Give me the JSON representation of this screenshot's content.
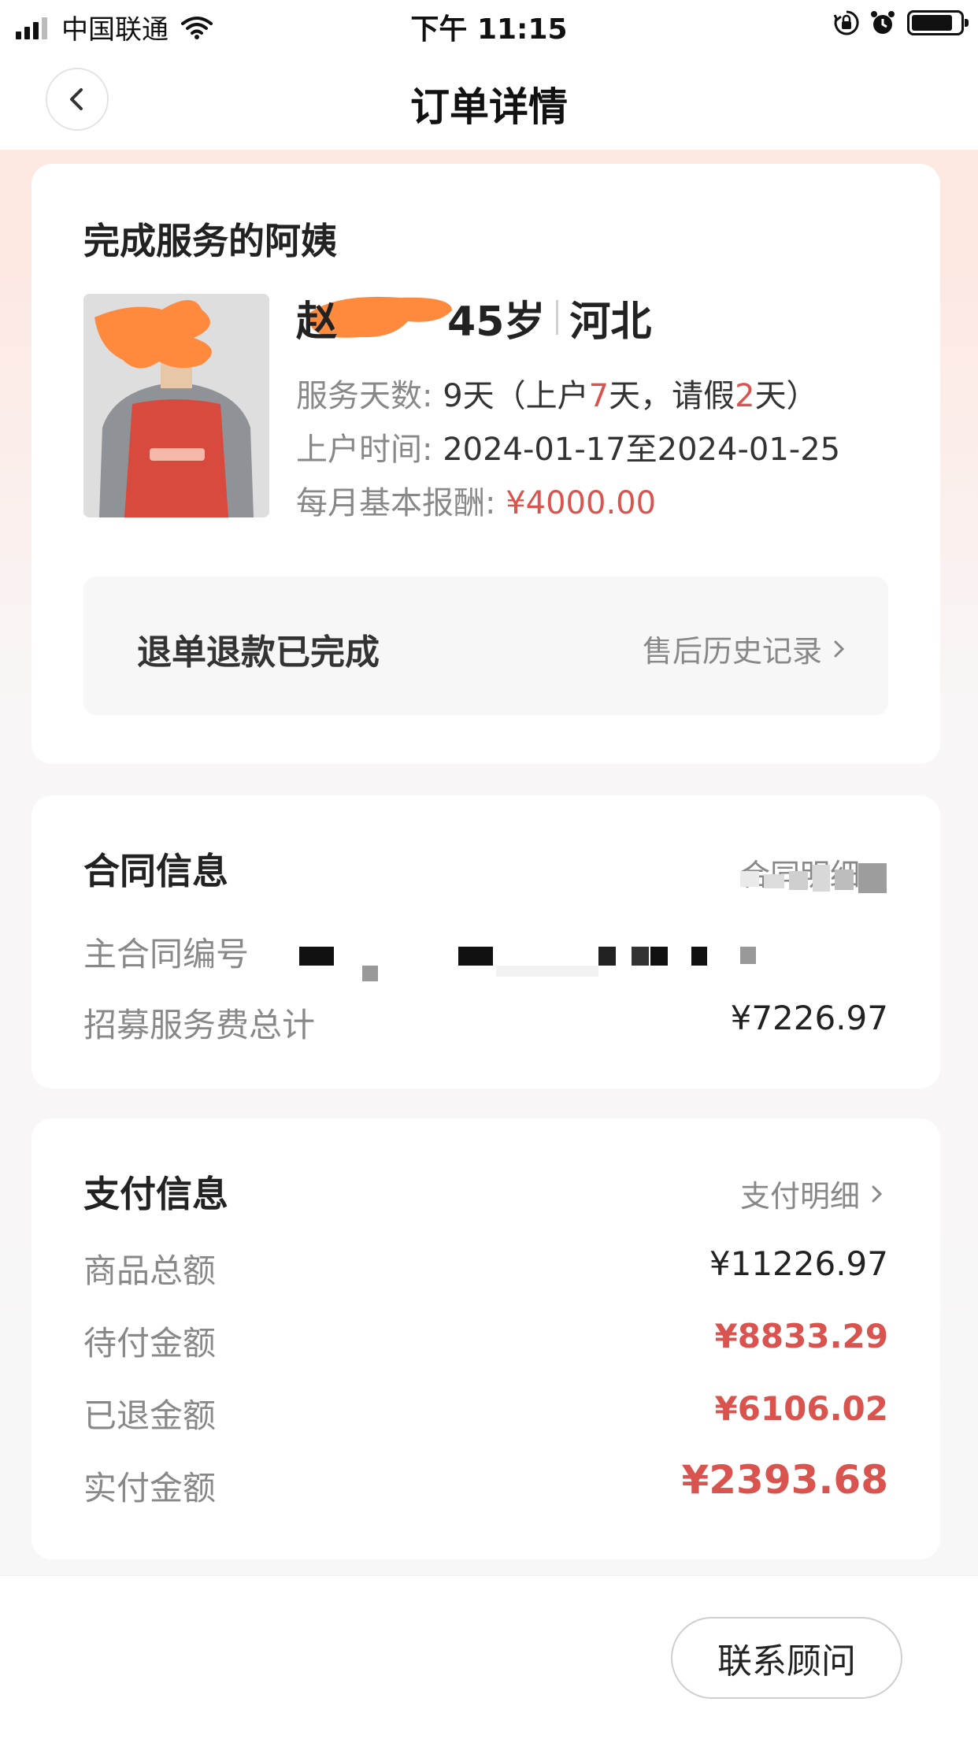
{
  "status_bar": {
    "carrier": "中国联通",
    "time": "下午 11:15"
  },
  "nav": {
    "title": "订单详情"
  },
  "ayi": {
    "section_title": "完成服务的阿姨",
    "name_partial": "赵",
    "age": "45岁",
    "origin": "河北",
    "service_days_label": "服务天数:",
    "service_days_value": "9天（上户",
    "onsite_days": "7",
    "middle_text": "天，请假",
    "leave_days": "2",
    "end_text": "天）",
    "onsite_time_label": "上户时间:",
    "onsite_time_value": "2024-01-17至2024-01-25",
    "salary_label": "每月基本报酬:",
    "salary_value": "¥4000.00",
    "refund_status": "退单退款已完成",
    "after_sale_link": "售后历史记录"
  },
  "contract": {
    "section_title": "合同信息",
    "detail_link": "合同明细",
    "number_label": "主合同编号",
    "fee_label": "招募服务费总计",
    "fee_value": "¥7226.97"
  },
  "payment": {
    "section_title": "支付信息",
    "detail_link": "支付明细",
    "rows": [
      {
        "label": "商品总额",
        "value": "¥11226.97"
      },
      {
        "label": "待付金额",
        "value": "¥8833.29"
      },
      {
        "label": "已退金额",
        "value": "¥6106.02"
      },
      {
        "label": "实付金额",
        "value": "¥2393.68"
      }
    ]
  },
  "bottom": {
    "contact_button": "联系顾问"
  },
  "colors": {
    "accent_red": "#d9534f",
    "redaction_orange": "#ff8a3d"
  },
  "icons": [
    "signal-icon",
    "wifi-icon",
    "orientation-lock-icon",
    "alarm-icon",
    "battery-icon",
    "back-arrow-icon",
    "chevron-right-icon"
  ]
}
